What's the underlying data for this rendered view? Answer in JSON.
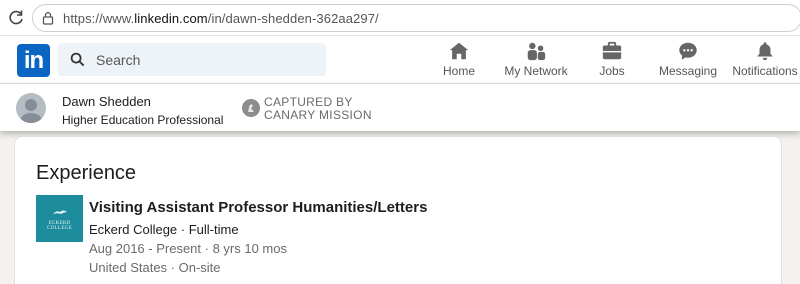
{
  "browser": {
    "url_prefix": "https://www.",
    "url_domain": "linkedin.com",
    "url_path": "/in/dawn-shedden-362aa297/"
  },
  "nav": {
    "logo": "in",
    "search_placeholder": "Search",
    "items": [
      {
        "label": "Home",
        "icon": "home-icon"
      },
      {
        "label": "My Network",
        "icon": "my-network-icon"
      },
      {
        "label": "Jobs",
        "icon": "jobs-icon"
      },
      {
        "label": "Messaging",
        "icon": "messaging-icon"
      },
      {
        "label": "Notifications",
        "icon": "notifications-icon"
      }
    ]
  },
  "profile": {
    "name": "Dawn Shedden",
    "headline": "Higher Education Professional",
    "watermark_line1": "CAPTURED BY",
    "watermark_line2": "CANARY MISSION"
  },
  "experience": {
    "title": "Experience",
    "items": [
      {
        "logo_text": "ECKERD COLLEGE",
        "role": "Visiting Assistant Professor Humanities/Letters",
        "company": "Eckerd College · Full-time",
        "dates": "Aug 2016 - Present · 8 yrs 10 mos",
        "location": "United States · On-site"
      }
    ]
  },
  "colors": {
    "linkedin_blue": "#0a66c2",
    "eckerd_teal": "#1d8c9c"
  }
}
